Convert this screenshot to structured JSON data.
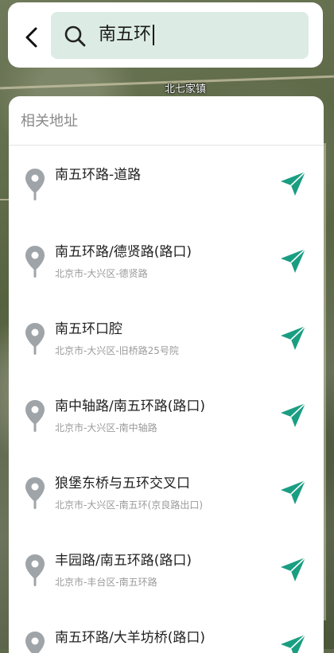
{
  "map": {
    "label": "北七家镇"
  },
  "search": {
    "back_icon": "chevron-left-icon",
    "search_icon": "search-icon",
    "query": "南五环"
  },
  "results": {
    "header": "相关地址",
    "pin_icon": "location-pin-icon",
    "nav_icon": "navigate-arrow-icon",
    "accent_color": "#1a9e82",
    "pin_color": "#9fa4a8",
    "items": [
      {
        "title": "南五环路-道路",
        "subtitle": ""
      },
      {
        "title": "南五环路/德贤路(路口)",
        "subtitle": "北京市-大兴区-德贤路"
      },
      {
        "title": "南五环口腔",
        "subtitle": "北京市-大兴区-旧桥路25号院"
      },
      {
        "title": "南中轴路/南五环路(路口)",
        "subtitle": "北京市-大兴区-南中轴路"
      },
      {
        "title": "狼堡东桥与五环交叉口",
        "subtitle": "北京市-大兴区-南五环(京良路出口)"
      },
      {
        "title": "丰园路/南五环路(路口)",
        "subtitle": "北京市-丰台区-南五环路"
      },
      {
        "title": "南五环路/大羊坊桥(路口)",
        "subtitle": ""
      }
    ]
  }
}
